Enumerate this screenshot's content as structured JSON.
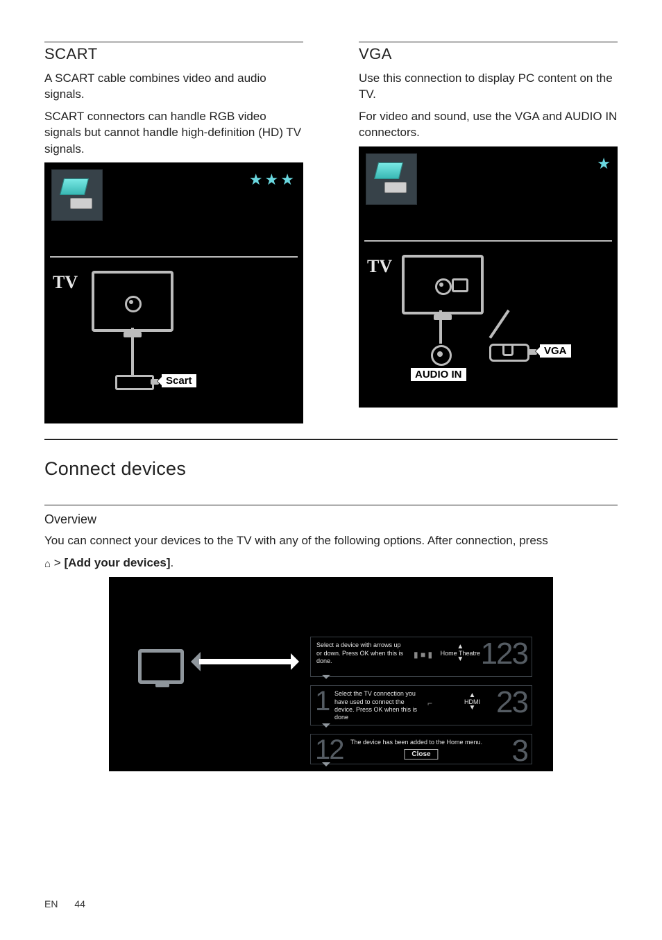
{
  "scart": {
    "heading": "SCART",
    "p1": "A SCART cable combines video and audio signals.",
    "p2": "SCART connectors can handle RGB video signals but cannot handle high-definition (HD) TV signals.",
    "stars": "★★★",
    "tv_label": "TV",
    "port_label": "Scart"
  },
  "vga": {
    "heading": "VGA",
    "p1": "Use this connection to display PC content on the TV.",
    "p2": "For video and sound, use the VGA and AUDIO IN connectors.",
    "stars": "★",
    "tv_label": "TV",
    "port_vga": "VGA",
    "port_audio": "AUDIO IN"
  },
  "connect": {
    "heading": "Connect devices",
    "subheading": "Overview",
    "intro": "You can connect your devices to the TV with any of the following options. After connection, press",
    "add_text": "[Add your devices]",
    "home_icon": "⌂",
    "gt": ">",
    "period": "."
  },
  "ov": {
    "p1_text": "Select a device with arrows up or down.\nPress OK when this is done.",
    "p1_sel": "Home Theatre",
    "p1_num": "123",
    "p2_text": "Select the TV connection you have used to connect the device. Press OK when this is done",
    "p2_sel": "HDMI",
    "p2_numL": "1",
    "p2_numR": "23",
    "p3_text": "The device has been added to the Home menu.",
    "p3_close": "Close",
    "p3_numL": "12",
    "p3_numR": "3"
  },
  "footer": {
    "lang": "EN",
    "page": "44"
  }
}
